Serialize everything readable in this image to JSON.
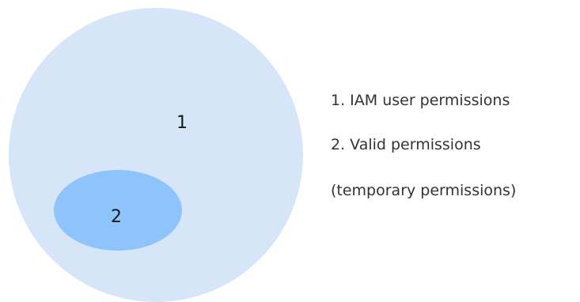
{
  "diagram": {
    "regions": [
      {
        "id": "1",
        "label": "1",
        "color": "#d6e6f8"
      },
      {
        "id": "2",
        "label": "2",
        "color": "#8ec3fb"
      }
    ],
    "legend": [
      "1. IAM user permissions",
      "2. Valid permissions",
      "(temporary permissions)"
    ]
  }
}
